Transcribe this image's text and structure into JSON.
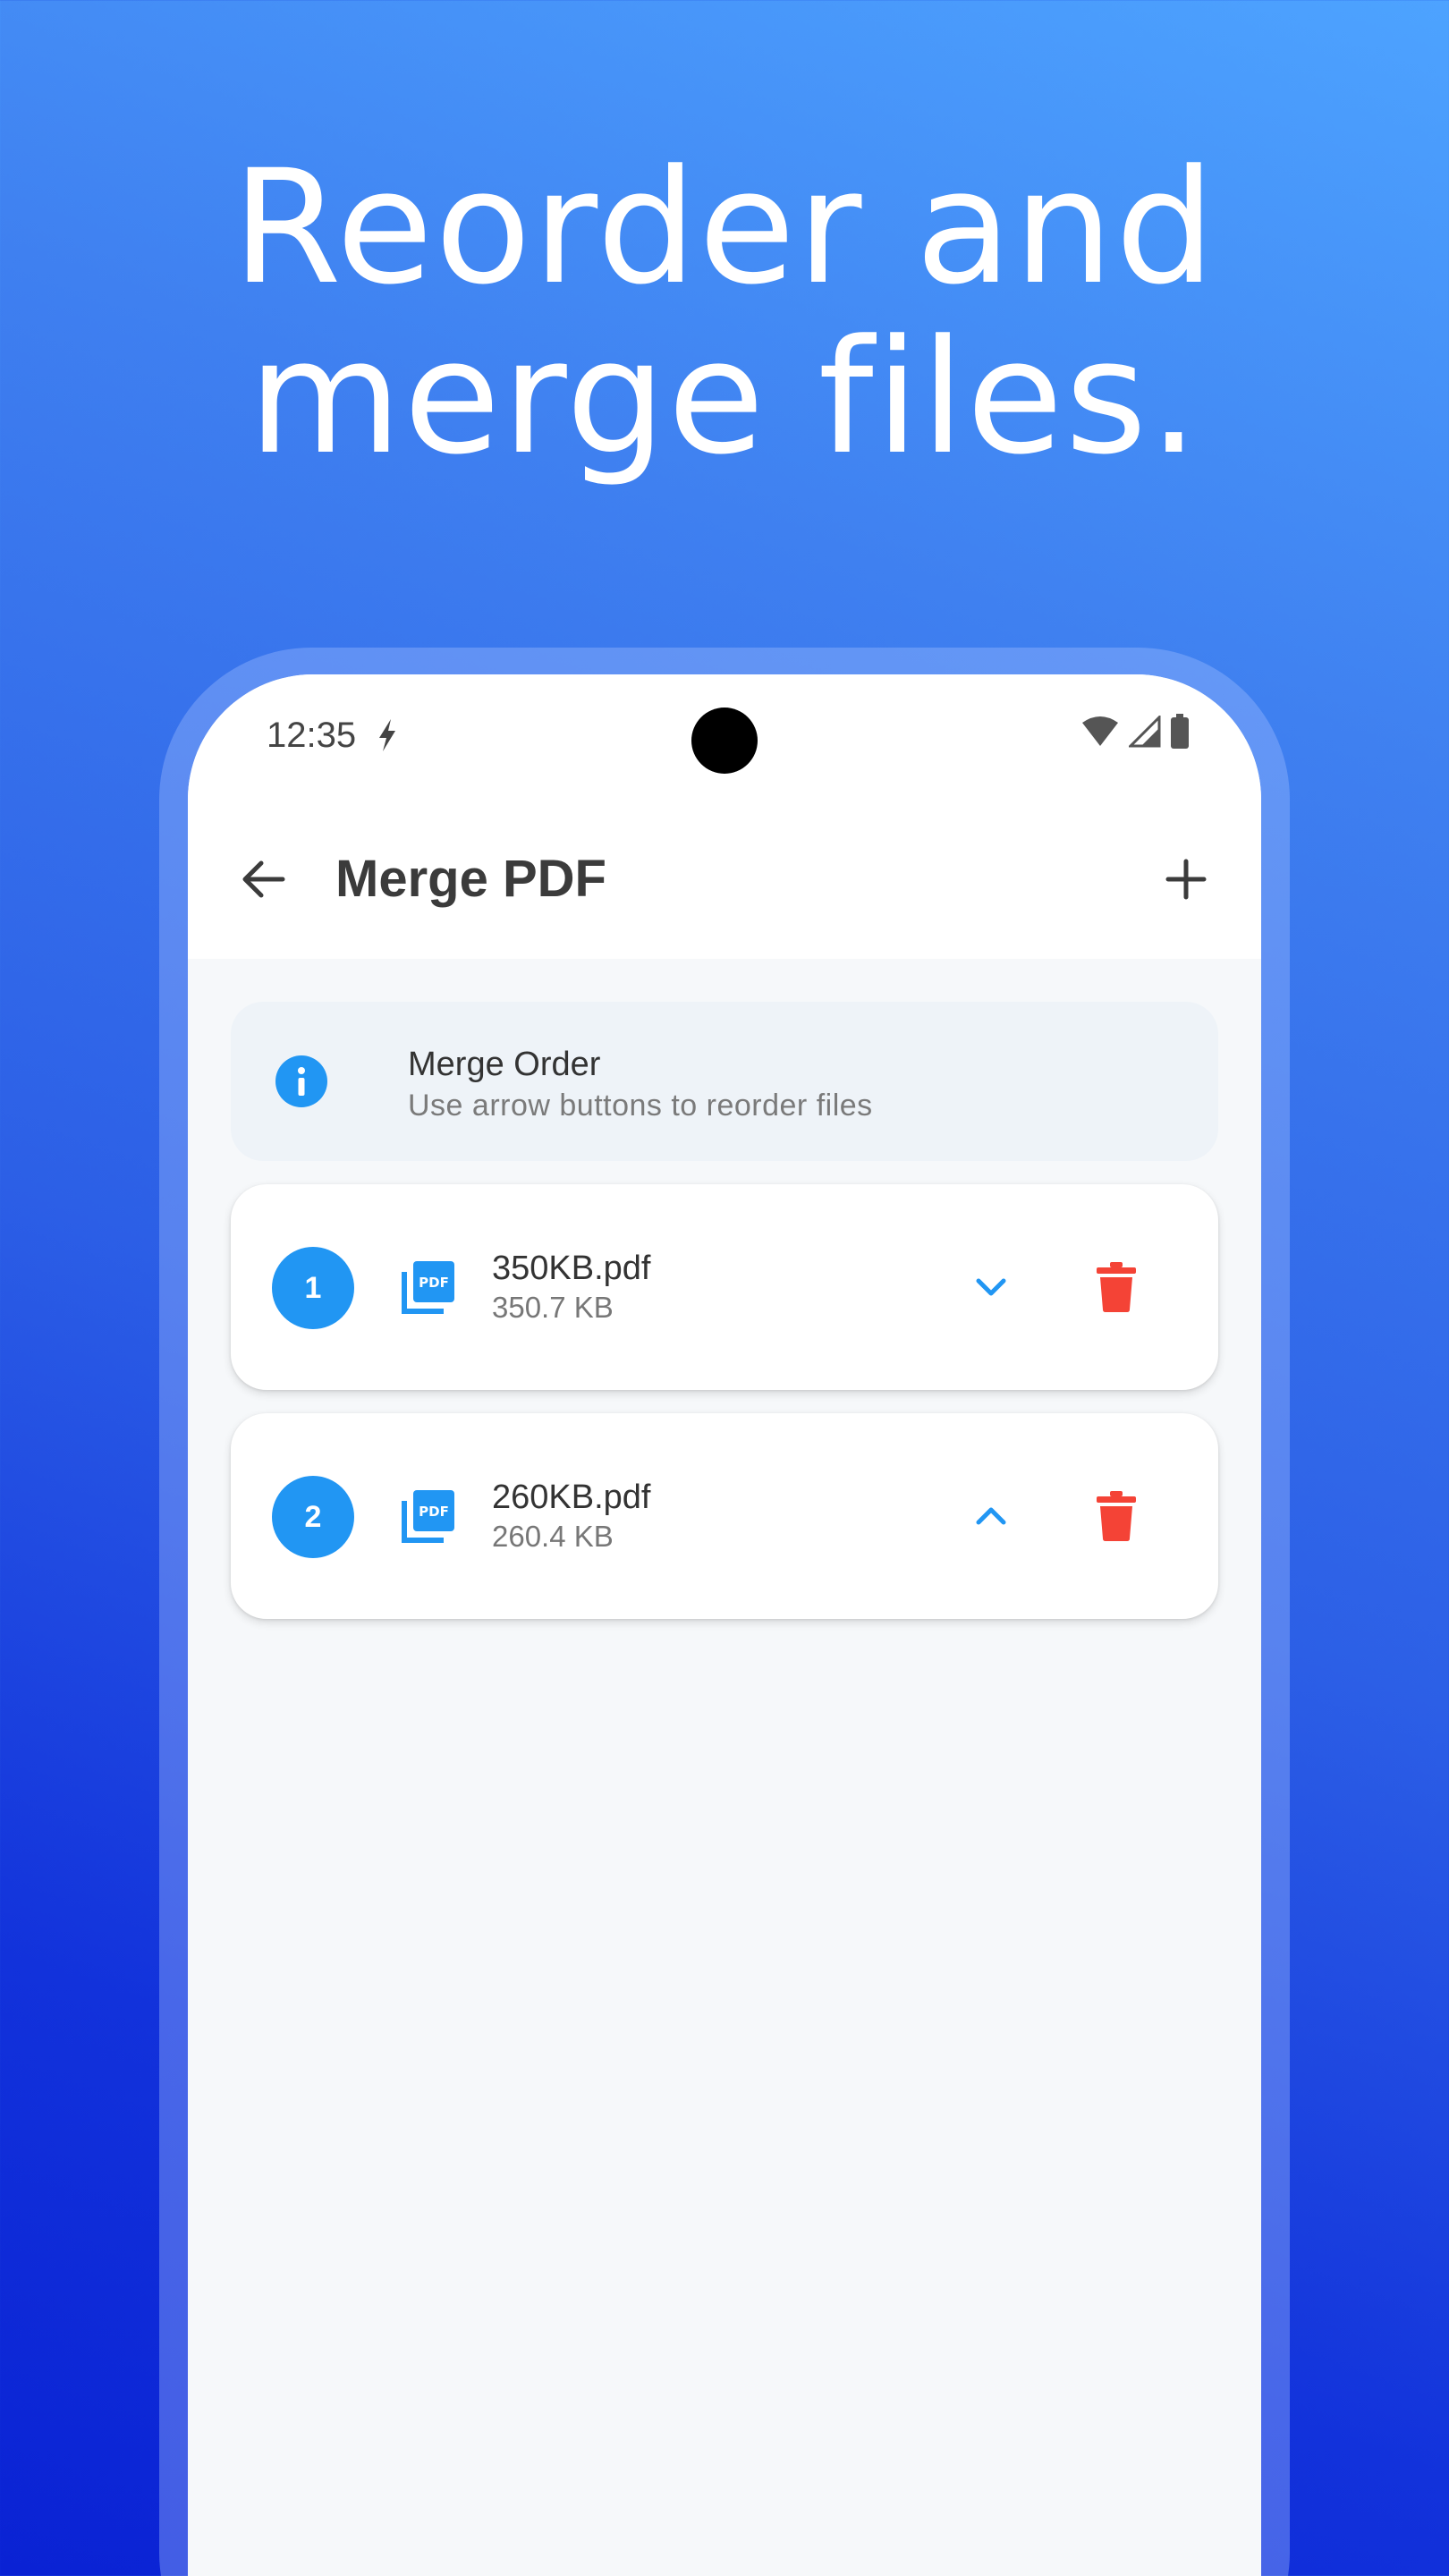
{
  "headline": {
    "line1": "Reorder and",
    "line2": "merge files."
  },
  "status_bar": {
    "time": "12:35",
    "icons": [
      "flash-icon",
      "wifi-icon",
      "signal-icon",
      "battery-icon"
    ]
  },
  "app_bar": {
    "title": "Merge PDF",
    "back_icon": "arrow-back-icon",
    "add_icon": "plus-icon"
  },
  "info_card": {
    "title": "Merge Order",
    "subtitle": "Use arrow buttons to reorder files",
    "icon": "info-icon"
  },
  "files": [
    {
      "order": "1",
      "name": "350KB.pdf",
      "size": "350.7 KB",
      "move_icon": "chevron-down-icon"
    },
    {
      "order": "2",
      "name": "260KB.pdf",
      "size": "260.4 KB",
      "move_icon": "chevron-up-icon"
    }
  ],
  "colors": {
    "accent": "#2196f3",
    "delete": "#f44336",
    "title_text": "#3b3b3b",
    "info_bg": "#eef3f8",
    "screen_bg": "#f6f8fa"
  }
}
